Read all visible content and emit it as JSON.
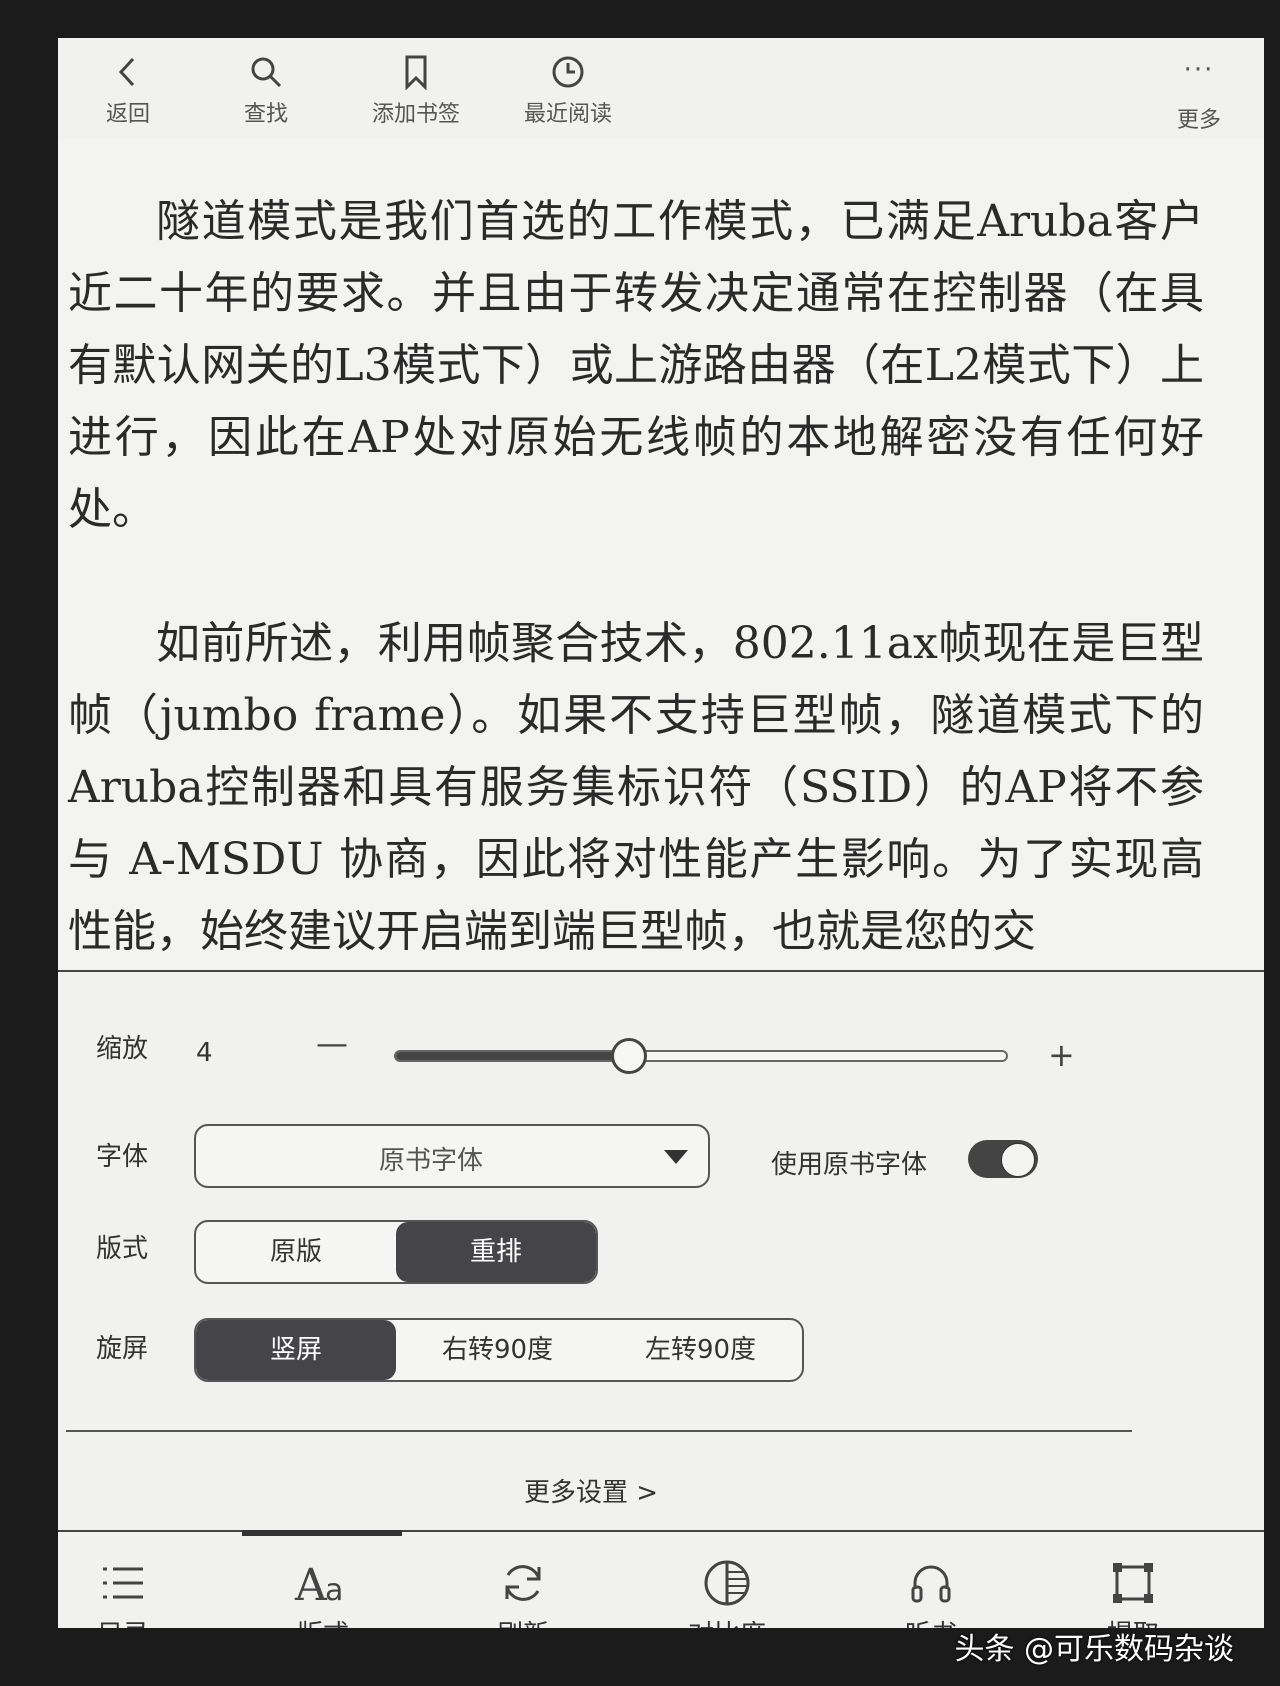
{
  "topbar": {
    "back": "返回",
    "search": "查找",
    "bookmark": "添加书签",
    "recent": "最近阅读",
    "more": "更多"
  },
  "content": {
    "paragraph1": "隧道模式是我们首选的工作模式，已满足Aruba客户近二十年的要求。并且由于转发决定通常在控制器（在具有默认网关的L3模式下）或上游路由器（在L2模式下）上进行，因此在AP处对原始无线帧的本地解密没有任何好处。",
    "paragraph2": "如前所述，利用帧聚合技术，802.11ax帧现在是巨型帧（jumbo frame）。如果不支持巨型帧，隧道模式下的Aruba控制器和具有服务集标识符（SSID）的AP将不参与 A-MSDU 协商，因此将对性能产生影响。为了实现高性能，始终建议开启端到端巨型帧，也就是您的交"
  },
  "settings": {
    "zoom_label": "缩放",
    "zoom_value": "4",
    "zoom_minus": "—",
    "zoom_plus": "+",
    "zoom_level_fraction": 0.38,
    "font_label": "字体",
    "font_selected": "原书字体",
    "use_original_font_label": "使用原书字体",
    "use_original_font_on": true,
    "layout_label": "版式",
    "layout_options": [
      "原版",
      "重排"
    ],
    "layout_active": 1,
    "rotate_label": "旋屏",
    "rotate_options": [
      "竖屏",
      "右转90度",
      "左转90度"
    ],
    "rotate_active": 0,
    "more_settings": "更多设置 >"
  },
  "bottombar": {
    "toc": "目录",
    "layout": "版式",
    "refresh": "刷新",
    "contrast": "对比度",
    "listen": "听书",
    "extract": "提取"
  },
  "watermark": "头条 @可乐数码杂谈"
}
